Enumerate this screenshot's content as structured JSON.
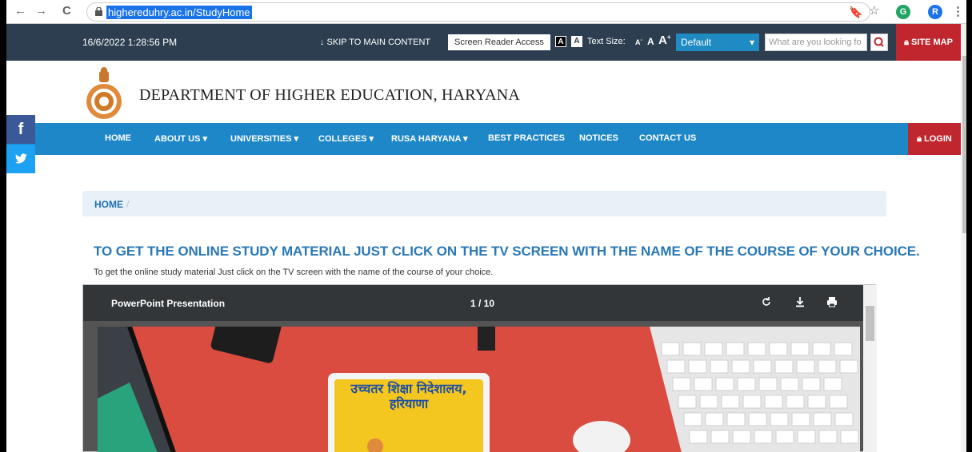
{
  "browser": {
    "url": "higheredu​hry.ac.in/StudyHome",
    "back": "←",
    "forward": "→",
    "reload": "C",
    "star": "☆",
    "avatar": "R",
    "more": "⋮"
  },
  "topbar": {
    "datetime": "16/6/2022 1:28:56 PM",
    "skip": "↓ SKIP TO MAIN CONTENT",
    "screen_reader": "Screen Reader Access",
    "contrast_dark": "A",
    "contrast_light": "A",
    "text_size_label": "Text Size:",
    "text_small": "A",
    "text_small_sup": "-",
    "text_normal": "A",
    "text_large": "A",
    "text_large_sup": "+",
    "theme_select": "Default",
    "search_placeholder": "What are you looking fo",
    "site_map": "SITE MAP"
  },
  "header": {
    "department": "DEPARTMENT OF HIGHER EDUCATION, HARYANA"
  },
  "menu": {
    "items": [
      "HOME",
      "ABOUT US ▾",
      "UNIVERSITIES ▾",
      "COLLEGES ▾",
      "RUSA HARYANA ▾",
      "BEST PRACTICES",
      "NOTICES",
      "CONTACT US"
    ],
    "login": "LOGIN"
  },
  "social": {
    "facebook": "f",
    "twitter": "t"
  },
  "breadcrumb": {
    "home": "HOME",
    "sep": "/"
  },
  "main": {
    "title": "TO GET THE ONLINE STUDY MATERIAL JUST CLICK ON THE TV SCREEN WITH THE NAME OF THE COURSE OF YOUR CHOICE.",
    "description": "To get the online study material Just click on the TV screen with the name of the course of your choice."
  },
  "viewer": {
    "title": "PowerPoint Presentation",
    "page": "1 / 10",
    "slide_text_line1": "उच्चतर शिक्षा निदेशालय,",
    "slide_text_line2": "हरियाणा"
  },
  "colors": {
    "topbar": "#2c3e50",
    "menu": "#1e87c7",
    "accent_red": "#c0262d",
    "title_blue": "#2a78b6"
  }
}
